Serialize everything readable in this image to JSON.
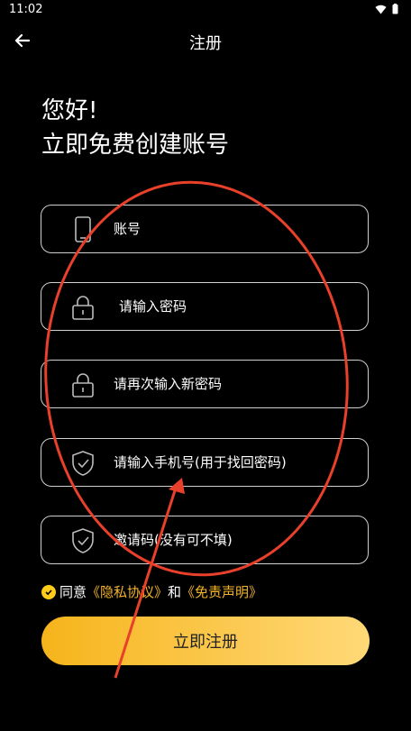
{
  "status_bar": {
    "time": "11:02"
  },
  "header": {
    "title": "注册"
  },
  "greeting": {
    "line1": "您好!",
    "line2": "立即免费创建账号"
  },
  "fields": {
    "account": {
      "placeholder": "账号",
      "icon": "phone-icon"
    },
    "password": {
      "placeholder": "请输入密码",
      "icon": "lock-icon"
    },
    "confirm_password": {
      "placeholder": "请再次输入新密码",
      "icon": "lock-icon"
    },
    "phone": {
      "placeholder": "请输入手机号(用于找回密码)",
      "icon": "shield-icon"
    },
    "invite": {
      "placeholder": "邀请码(没有可不填)",
      "icon": "shield-icon"
    }
  },
  "agreement": {
    "prefix": "同意",
    "privacy": "《隐私协议》",
    "and": "和",
    "disclaimer": "《免责声明》"
  },
  "submit": {
    "label": "立即注册"
  },
  "colors": {
    "accent": "#f4b328",
    "annotation": "#e8402a",
    "background": "#000000"
  }
}
